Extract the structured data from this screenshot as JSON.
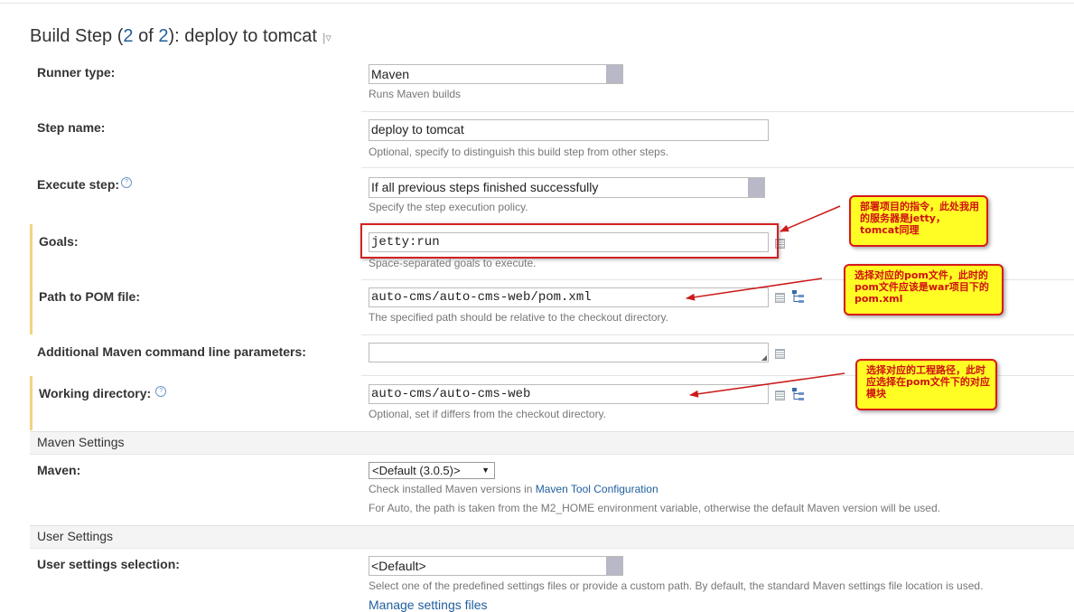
{
  "title": {
    "prefix": "Build Step (",
    "num": "2",
    "mid": " of ",
    "total": "2",
    "suffix": "): deploy to tomcat",
    "caret": "|▿"
  },
  "runner": {
    "label": "Runner type:",
    "value": "Maven",
    "hint": "Runs Maven builds"
  },
  "step_name": {
    "label": "Step name:",
    "value": "deploy to tomcat",
    "hint": "Optional, specify to distinguish this build step from other steps."
  },
  "execute_step": {
    "label": "Execute step:",
    "value": "If all previous steps finished successfully",
    "hint": "Specify the step execution policy."
  },
  "goals": {
    "label": "Goals:",
    "value": "jetty:run",
    "hint": "Space-separated goals to execute."
  },
  "pom": {
    "label": "Path to POM file:",
    "value": "auto-cms/auto-cms-web/pom.xml",
    "hint": "The specified path should be relative to the checkout directory."
  },
  "maven_params": {
    "label": "Additional Maven command line parameters:",
    "value": ""
  },
  "working_dir": {
    "label": "Working directory:",
    "value": "auto-cms/auto-cms-web",
    "hint": "Optional, set if differs from the checkout directory."
  },
  "maven_settings": {
    "section": "Maven Settings",
    "label": "Maven:",
    "value": "<Default (3.0.5)>",
    "hint_prefix": "Check installed Maven versions in ",
    "hint_link": "Maven Tool Configuration",
    "hint2": "For Auto, the path is taken from the M2_HOME environment variable, otherwise the default Maven version will be used."
  },
  "user_settings": {
    "section": "User Settings",
    "label": "User settings selection:",
    "value": "<Default>",
    "hint": "Select one of the predefined settings files or provide a custom path. By default, the standard Maven settings file location is used.",
    "link": "Manage settings files"
  },
  "annotations": {
    "goals_note": "部署项目的指令，此处我用的服务器是jetty，tomcat同理",
    "pom_note": "选择对应的pom文件，此时的pom文件应该是war项目下的pom.xml",
    "workdir_note": "选择对应的工程路径，此时应选择在pom文件下的对应模块"
  },
  "colors": {
    "accent": "#1f5e9f",
    "annotation_border": "#d81a1a",
    "annotation_fill": "#fffd24",
    "highlight_bar": "#f0d480"
  },
  "icons": [
    "help-icon",
    "edit-lines-icon",
    "tree-browse-icon",
    "dropdown-arrow-icon",
    "resize-handle-icon"
  ]
}
